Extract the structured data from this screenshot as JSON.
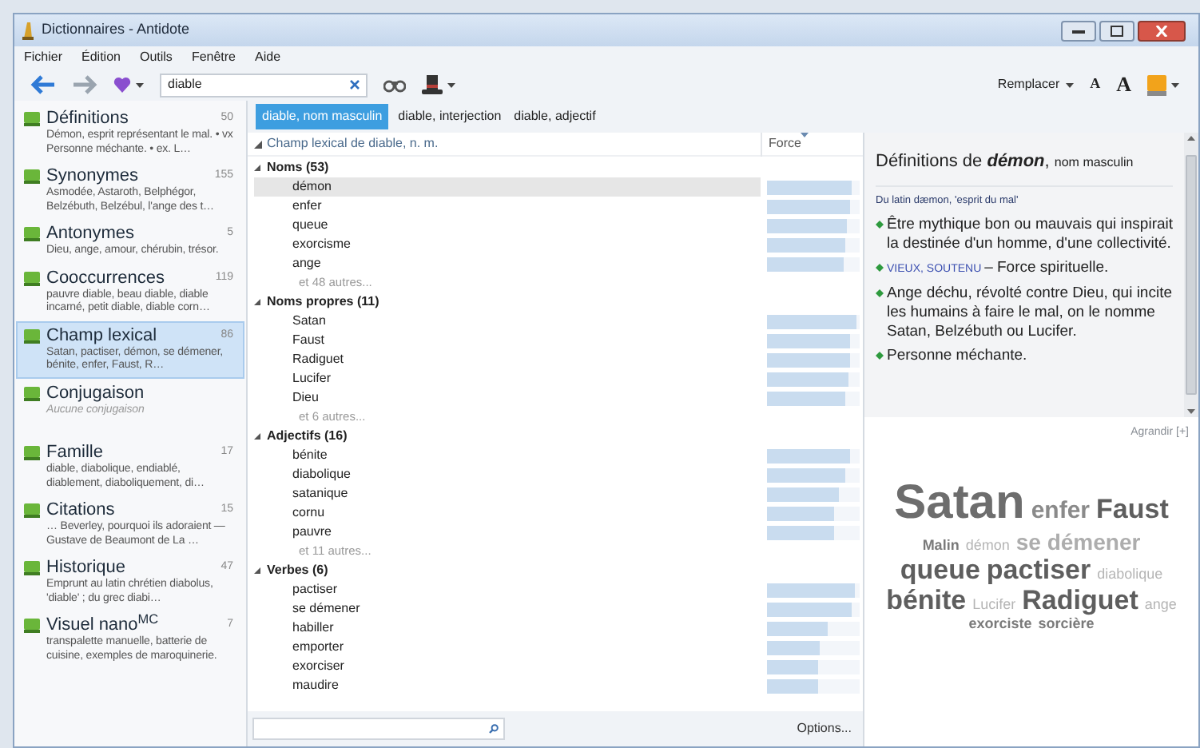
{
  "window": {
    "title": "Dictionnaires - Antidote"
  },
  "menu": [
    {
      "label": "Fichier"
    },
    {
      "label": "Édition"
    },
    {
      "label": "Outils"
    },
    {
      "label": "Fenêtre"
    },
    {
      "label": "Aide"
    }
  ],
  "toolbar": {
    "search_value": "diable",
    "replace_label": "Remplacer",
    "font_small": "A",
    "font_large": "A"
  },
  "entry_tabs": [
    {
      "label": "diable, nom masculin",
      "selected": true
    },
    {
      "label": "diable, interjection",
      "selected": false
    },
    {
      "label": "diable, adjectif",
      "selected": false
    }
  ],
  "sidebar": {
    "items": [
      {
        "title": "Définitions",
        "count": "50",
        "summary": "Démon, esprit représentant le mal. • vx Personne méchante. • ex. L…",
        "available": true,
        "selected": false
      },
      {
        "title": "Synonymes",
        "count": "155",
        "summary": "Asmodée, Astaroth, Belphégor, Belzébuth, Belzébul, l'ange des t…",
        "available": true,
        "selected": false
      },
      {
        "title": "Antonymes",
        "count": "5",
        "summary": "Dieu, ange, amour, chérubin, trésor.",
        "available": true,
        "selected": false
      },
      {
        "title": "Cooccurrences",
        "count": "119",
        "summary": "pauvre diable, beau diable, diable incarné, petit diable, diable corn…",
        "available": true,
        "selected": false
      },
      {
        "title": "Champ lexical",
        "count": "86",
        "summary": "Satan, pactiser, démon, se démener, bénite, enfer, Faust, R…",
        "available": true,
        "selected": true
      },
      {
        "title": "Conjugaison",
        "summary": "Aucune conjugaison",
        "available": false,
        "selected": false
      },
      {
        "title": "Famille",
        "count": "17",
        "summary": "diable, diabolique, endiablé, diablement, diaboliquement, di…",
        "available": true,
        "selected": false
      },
      {
        "title": "Citations",
        "count": "15",
        "summary": "… Beverley, pourquoi ils adoraient — Gustave de Beaumont de La …",
        "available": true,
        "selected": false
      },
      {
        "title": "Historique",
        "count": "47",
        "summary": "Emprunt au latin chrétien diabolus, 'diable' ; du grec diabi…",
        "available": true,
        "selected": false
      },
      {
        "title": "Visuel nano$^{MC}$",
        "count": "7",
        "summary": "transpalette manuelle, batterie de cuisine, exemples de maroquinerie.",
        "available": true,
        "selected": false
      }
    ]
  },
  "lexical_field": {
    "heading": "Champ lexical de diable, n. m.",
    "column": "Force",
    "expanded": true,
    "sections": [
      {
        "label": "Noms (53)",
        "expanded": true,
        "more": "et 48 autres...",
        "items": [
          {
            "word": "démon",
            "level": 0.92,
            "selected": true
          },
          {
            "word": "enfer",
            "level": 0.9,
            "selected": false
          },
          {
            "word": "queue",
            "level": 0.87,
            "selected": false
          },
          {
            "word": "exorcisme",
            "level": 0.85,
            "selected": false
          },
          {
            "word": "ange",
            "level": 0.83,
            "selected": false
          }
        ]
      },
      {
        "label": "Noms propres (11)",
        "expanded": true,
        "more": "et 6 autres...",
        "items": [
          {
            "word": "Satan",
            "level": 0.97,
            "selected": false
          },
          {
            "word": "Faust",
            "level": 0.9,
            "selected": false
          },
          {
            "word": "Radiguet",
            "level": 0.9,
            "selected": false
          },
          {
            "word": "Lucifer",
            "level": 0.88,
            "selected": false
          },
          {
            "word": "Dieu",
            "level": 0.85,
            "selected": false
          }
        ]
      },
      {
        "label": "Adjectifs (16)",
        "expanded": true,
        "more": "et 11 autres...",
        "items": [
          {
            "word": "bénite",
            "level": 0.9,
            "selected": false
          },
          {
            "word": "diabolique",
            "level": 0.84,
            "selected": false
          },
          {
            "word": "satanique",
            "level": 0.78,
            "selected": false
          },
          {
            "word": "cornu",
            "level": 0.73,
            "selected": false
          },
          {
            "word": "pauvre",
            "level": 0.73,
            "selected": false
          }
        ]
      },
      {
        "label": "Verbes (6)",
        "expanded": true,
        "items": [
          {
            "word": "pactiser",
            "level": 0.94,
            "selected": false
          },
          {
            "word": "se démener",
            "level": 0.91,
            "selected": false
          },
          {
            "word": "habiller",
            "level": 0.66,
            "selected": false
          },
          {
            "word": "emporter",
            "level": 0.57,
            "selected": false
          },
          {
            "word": "exorciser",
            "level": 0.56,
            "selected": false
          },
          {
            "word": "maudire",
            "level": 0.56,
            "selected": false
          }
        ]
      }
    ]
  },
  "options_button": "Options...",
  "definition_panel": {
    "title": "Définitions de **démon**,",
    "category": "nom masculin",
    "etymology": "Du latin dæmon, 'esprit du mal'",
    "definitions": [
      {
        "text": "Être mythique bon ou mauvais qui inspirait la destinée d'un homme, d'une collectivité."
      },
      {
        "register": "VIEUX, SOUTENU",
        "text": "– Force spirituelle."
      },
      {
        "text": "Ange déchu, révolté contre Dieu, qui incite les humains à faire le mal, on le nomme Satan, Belzébuth ou Lucifer."
      },
      {
        "text": "Personne méchante."
      }
    ]
  },
  "word_cloud": {
    "enlarge_link": "Agrandir [+]",
    "words": [
      {
        "word": "Satan",
        "kind": "xl"
      },
      {
        "word": "enfer",
        "kind": "md"
      },
      {
        "word": "Faust",
        "kind": "lg"
      },
      {
        "word": "Malin",
        "kind": "sm"
      },
      {
        "word": "démon",
        "kind": "faint"
      },
      {
        "word": "se démener",
        "kind": "light"
      },
      {
        "word": "queue",
        "kind": "lg"
      },
      {
        "word": "pactiser",
        "kind": "lg"
      },
      {
        "word": "diabolique",
        "kind": "faint"
      },
      {
        "word": "bénite",
        "kind": "lg"
      },
      {
        "word": "Lucifer",
        "kind": "faint"
      },
      {
        "word": "Radiguet",
        "kind": "lg"
      },
      {
        "word": "ange",
        "kind": "faint"
      },
      {
        "word": "exorciste",
        "kind": "sm"
      },
      {
        "word": "sorcière",
        "kind": "sm"
      }
    ]
  }
}
